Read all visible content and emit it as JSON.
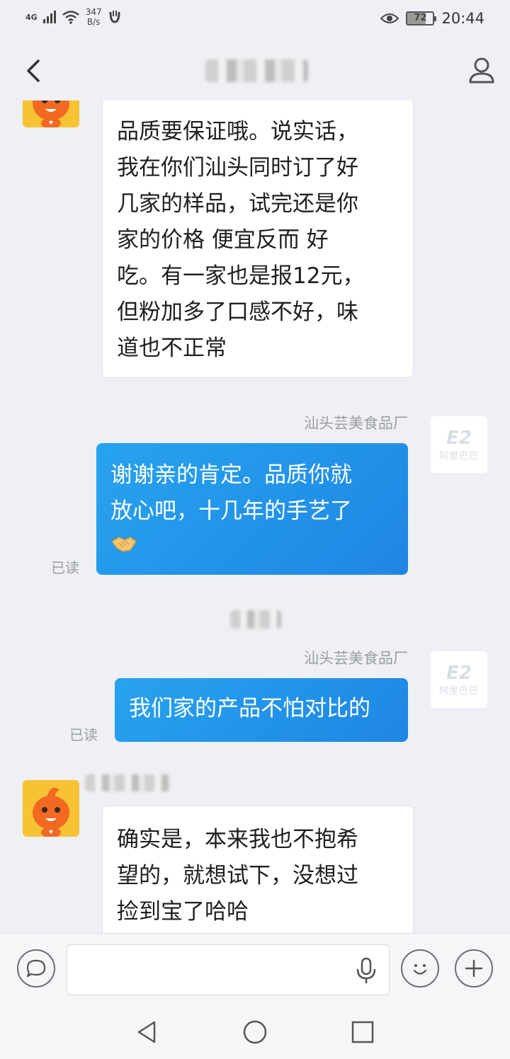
{
  "status_bar": {
    "network": "4G",
    "speed_value": "347",
    "speed_unit": "B/s",
    "battery": "72",
    "time": "20:44"
  },
  "header": {
    "title_blurred": ""
  },
  "messages": [
    {
      "type": "incoming",
      "text_lines": [
        "品质要保证哦。说实话，",
        "我在你们汕头同时订了好",
        "几家的样品，试完还是你",
        "家的价格 便宜反而 好",
        "吃。有一家也是报12元，",
        "但粉加多了口感不好，味",
        "道也不正常"
      ]
    },
    {
      "type": "outgoing",
      "sender": "汕头芸美食品厂",
      "text_lines": [
        "谢谢亲的肯定。品质你就",
        "放心吧，十几年的手艺了"
      ],
      "emoji": "handshake-emoji",
      "read": "已读"
    },
    {
      "type": "outgoing",
      "sender": "汕头芸美食品厂",
      "text_lines": [
        "我们家的产品不怕对比的"
      ],
      "read": "已读"
    },
    {
      "type": "incoming",
      "text_lines": [
        "确实是，本来我也不抱希",
        "望的，就想试下，没想过",
        "捡到宝了哈哈"
      ]
    }
  ],
  "avatar_brand": {
    "mark": "E2",
    "text": "阿里巴巴"
  },
  "input": {
    "placeholder": ""
  },
  "icons": {
    "back": "chevron-left-icon",
    "profile": "person-icon",
    "message": "chat-bubble-icon",
    "mic": "microphone-icon",
    "emoji": "smiley-icon",
    "add": "plus-icon",
    "nav_back": "triangle-back-icon",
    "nav_home": "circle-home-icon",
    "nav_recent": "square-recent-icon"
  },
  "colors": {
    "background": "#eef0f5",
    "outgoing_bubble": "#1f86e3",
    "incoming_bubble": "#ffffff",
    "avatar": "#f7c335"
  }
}
